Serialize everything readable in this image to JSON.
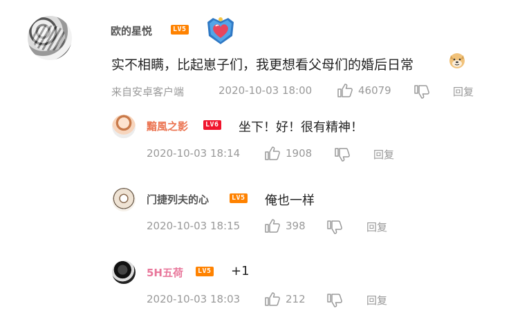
{
  "main_comment": {
    "username": "欧的星悦",
    "level": "LV5",
    "text": "实不相瞒，比起崽子们，我更想看父母们的婚后日常",
    "source": "来自安卓客户端",
    "time": "2020-10-03 18:00",
    "likes": "46079",
    "reply_label": "回复"
  },
  "replies": [
    {
      "username": "黯風之影",
      "level": "LV6",
      "text": "坐下！好！很有精神！",
      "time": "2020-10-03 18:14",
      "likes": "1908",
      "reply_label": "回复"
    },
    {
      "username": "门捷列夫的心",
      "level": "LV5",
      "text": "俺也一样",
      "time": "2020-10-03 18:15",
      "likes": "398",
      "reply_label": "回复"
    },
    {
      "username": "5H五荷",
      "level": "LV5",
      "text": "+1",
      "time": "2020-10-03 18:03",
      "likes": "212",
      "reply_label": "回复"
    }
  ],
  "colors": {
    "level_orange": "#ff8200",
    "level_red": "#f0142d",
    "name_highlight": "#eb7350",
    "meta_gray": "#999999"
  },
  "icons": [
    "like-icon",
    "dislike-icon",
    "badge-icon",
    "doge-emoji"
  ]
}
